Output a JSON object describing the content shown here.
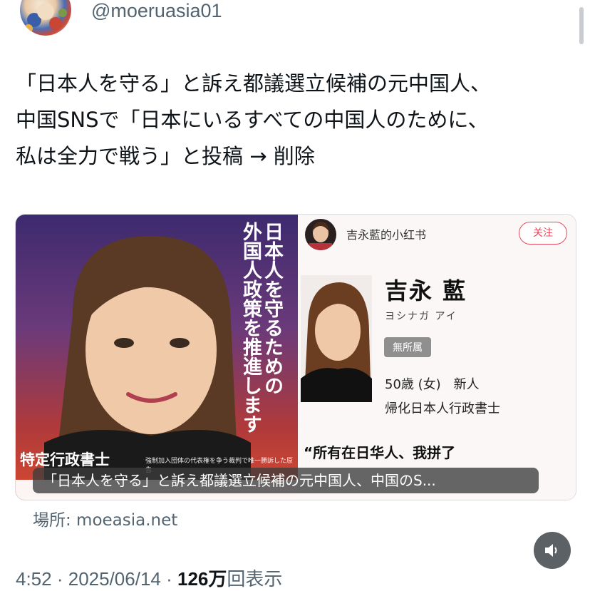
{
  "author": {
    "handle": "@moeruasia01"
  },
  "tweet": {
    "lines": [
      "「日本人を守る」と訴え都議選立候補の元中国人、",
      "中国SNSで「日本にいるすべての中国人のために、",
      "私は全力で戦う」と投稿 → 削除"
    ]
  },
  "card": {
    "poster": {
      "vertical_lines": [
        "日本人を守るための",
        "外国人政策を推進します"
      ],
      "title": "特定行政書士",
      "subtitle": "強制加入団体の代表権を争う裁判で唯一勝訴した原告"
    },
    "profile": {
      "account_name": "吉永藍的小红书",
      "follow_label": "关注",
      "name": "吉永 藍",
      "kana": "ヨシナガ アイ",
      "party": "無所属",
      "age_line": "50歳 (女)　新人",
      "job_line": "帰化日本人行政書士",
      "quote": "“所有在日华人、我拼了"
    },
    "caption": "「日本人を守る」と訴え都議選立候補の元中国人、中国のS..."
  },
  "source": {
    "label": "場所: moeasia.net"
  },
  "meta": {
    "time": "4:52",
    "date": "2025/06/14",
    "views_count": "126万",
    "views_label": "回表示"
  },
  "icons": {
    "mute": "speaker-muted-icon"
  }
}
